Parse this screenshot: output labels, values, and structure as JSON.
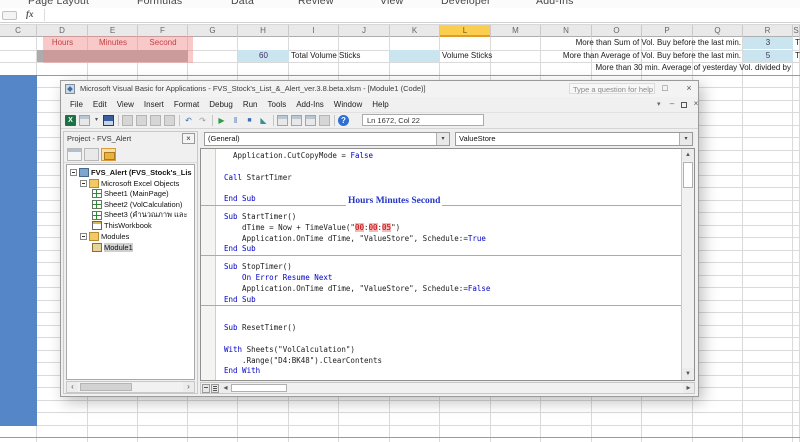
{
  "icons": {
    "minimize": "–",
    "maximize": "□",
    "close": "×",
    "dropdown": "▾",
    "scroll_up": "▲",
    "scroll_down": "▼",
    "scroll_left": "◂",
    "scroll_right": "▸",
    "hsb_left": "‹",
    "hsb_right": "›"
  },
  "colors": {
    "keyword": "#0000C6",
    "code_text": "#1C1C1C",
    "annotation": "#2536C8",
    "highlight_bg": "#F6B8B8",
    "highlight_text": "#C00000",
    "excel_blue_column": "#5587C8",
    "excel_cell_blue": "#CBE5F0",
    "excel_header_selected": "#FBCE4F",
    "excel_label_red": "#9C0006",
    "excel_gray_fill": "#ACACAC",
    "pink_overlay": "rgba(241,132,132,0.45)"
  },
  "excel": {
    "ribbon_tabs": [
      "Page Layout",
      "Formulas",
      "Data",
      "Review",
      "View",
      "Developer",
      "Add-Ins"
    ],
    "fx_label": "fx",
    "columns": [
      "C",
      "D",
      "E",
      "F",
      "G",
      "H",
      "I",
      "J",
      "K",
      "L",
      "M",
      "N",
      "O",
      "P",
      "Q",
      "R",
      "S"
    ],
    "highlighted_column": "L",
    "cells": [
      {
        "col": "D",
        "row": 1,
        "text": "Hours",
        "align": "center",
        "style": "red-label"
      },
      {
        "col": "E",
        "row": 1,
        "text": "Minutes",
        "align": "center",
        "style": "red-label"
      },
      {
        "col": "F",
        "row": 1,
        "text": "Second",
        "align": "center",
        "style": "red-label"
      },
      {
        "col": "D",
        "row": 2,
        "text": "",
        "style": "gray-fill"
      },
      {
        "col": "E",
        "row": 2,
        "text": "",
        "style": "gray-fill"
      },
      {
        "col": "F",
        "row": 2,
        "text": "",
        "style": "gray-fill"
      },
      {
        "col": "H",
        "row": 2,
        "text": "60",
        "align": "center",
        "style": "blue-fill value"
      },
      {
        "cols": [
          "I",
          "J"
        ],
        "row": 2,
        "text": "Total Volume Sticks",
        "align": "left",
        "style": ""
      },
      {
        "col": "K",
        "row": 2,
        "text": "",
        "style": "blue-fill"
      },
      {
        "col": "L",
        "row": 2,
        "text": "Volume Sticks",
        "align": "left",
        "style": ""
      },
      {
        "cols": [
          "M",
          "Q"
        ],
        "row": 1,
        "text": "More than Sum of Vol. Buy before the last min.",
        "align": "right",
        "style": ""
      },
      {
        "col": "R",
        "row": 1,
        "text": "3",
        "align": "center",
        "style": "blue-fill value"
      },
      {
        "cols": [
          "M",
          "Q"
        ],
        "row": 2,
        "text": "More than Average of Vol. Buy before the last min.",
        "align": "right",
        "style": ""
      },
      {
        "col": "R",
        "row": 2,
        "text": "5",
        "align": "center",
        "style": "blue-fill value"
      },
      {
        "cols": [
          "M",
          "R"
        ],
        "row": 3,
        "text": "More than 30 min. Average of yesterday Vol. divided by",
        "align": "right",
        "style": ""
      },
      {
        "col": "S",
        "row": 1,
        "text": "T",
        "align": "left",
        "style": ""
      },
      {
        "col": "S",
        "row": 2,
        "text": "T",
        "align": "left",
        "style": ""
      }
    ]
  },
  "vba": {
    "title": "Microsoft Visual Basic for Applications - FVS_Stock's_List_&_Alert_ver.3.8.beta.xlsm - [Module1 (Code)]",
    "menus": [
      "File",
      "Edit",
      "View",
      "Insert",
      "Format",
      "Debug",
      "Run",
      "Tools",
      "Add-Ins",
      "Window",
      "Help"
    ],
    "help_placeholder": "Type a question for help",
    "status_line": "Ln 1672, Col 22",
    "toolbar": [
      {
        "name": "excel-icon",
        "kind": "excel",
        "glyph": "X"
      },
      {
        "name": "view-object-icon",
        "kind": "win"
      },
      {
        "name": "dropdown-arrow-icon",
        "kind": "dd",
        "glyph": "▾"
      },
      {
        "name": "save-icon",
        "kind": "save"
      },
      {
        "name": "toolbar-separator",
        "kind": "sep"
      },
      {
        "name": "cut-icon",
        "kind": "gray"
      },
      {
        "name": "copy-icon",
        "kind": "gray"
      },
      {
        "name": "paste-icon",
        "kind": "gray"
      },
      {
        "name": "find-icon",
        "kind": "gray"
      },
      {
        "name": "toolbar-separator",
        "kind": "sep"
      },
      {
        "name": "undo-icon",
        "kind": "glyph-blue",
        "glyph": "↶"
      },
      {
        "name": "redo-icon",
        "kind": "glyph-gray",
        "glyph": "↷"
      },
      {
        "name": "toolbar-separator",
        "kind": "sep"
      },
      {
        "name": "run-icon",
        "kind": "glyph-green",
        "glyph": "▶"
      },
      {
        "name": "break-icon",
        "kind": "glyph-blue",
        "glyph": "‖"
      },
      {
        "name": "stop-icon",
        "kind": "glyph-navy",
        "glyph": "■"
      },
      {
        "name": "design-mode-icon",
        "kind": "glyph-teal",
        "glyph": "◣"
      },
      {
        "name": "toolbar-separator",
        "kind": "sep"
      },
      {
        "name": "project-explorer-icon",
        "kind": "win"
      },
      {
        "name": "properties-window-icon",
        "kind": "win"
      },
      {
        "name": "object-browser-icon",
        "kind": "win"
      },
      {
        "name": "toolbox-icon",
        "kind": "gray"
      },
      {
        "name": "toolbar-separator",
        "kind": "sep"
      },
      {
        "name": "help-icon",
        "kind": "glyph-help",
        "glyph": "?"
      }
    ],
    "project": {
      "title": "Project - FVS_Alert",
      "items": [
        {
          "label": "FVS_Alert (FVS_Stock's_Lis",
          "icon": "vbproject",
          "level": 0,
          "expander": true,
          "bold": true
        },
        {
          "label": "Microsoft Excel Objects",
          "icon": "folder",
          "level": 1,
          "expander": true
        },
        {
          "label": "Sheet1 (MainPage)",
          "icon": "worksheet",
          "level": 2
        },
        {
          "label": "Sheet2 (VolCalculation)",
          "icon": "worksheet",
          "level": 2
        },
        {
          "label": "Sheet3 (คำนวณภาพ และ",
          "icon": "worksheet",
          "level": 2
        },
        {
          "label": "ThisWorkbook",
          "icon": "workbook",
          "level": 2
        },
        {
          "label": "Modules",
          "icon": "folder",
          "level": 1,
          "expander": true
        },
        {
          "label": "Module1",
          "icon": "module",
          "level": 2,
          "selected": true
        }
      ]
    },
    "combos": {
      "left": "(General)",
      "right": "ValueStore"
    },
    "annotation": {
      "text": "Hours Minutes Second"
    },
    "code": [
      [
        [
          "n",
          "  Application.CutCopyMode = "
        ],
        [
          "k",
          "False"
        ]
      ],
      "blank",
      [
        [
          "k",
          "Call"
        ],
        [
          "n",
          " StartTimer"
        ]
      ],
      "blank",
      [
        [
          "k",
          "End Sub"
        ]
      ],
      "sep",
      [
        [
          "k",
          "Sub"
        ],
        [
          "n",
          " StartTimer()"
        ]
      ],
      [
        [
          "n",
          "    dTime = Now + TimeValue(\""
        ],
        [
          "hl",
          "00"
        ],
        [
          "n",
          ":"
        ],
        [
          "hl",
          "00"
        ],
        [
          "n",
          ":"
        ],
        [
          "hl",
          "05"
        ],
        [
          "n",
          "\")"
        ]
      ],
      [
        [
          "n",
          "    Application.OnTime dTime, \"ValueStore\", Schedule:="
        ],
        [
          "k",
          "True"
        ]
      ],
      [
        [
          "k",
          "End Sub"
        ]
      ],
      "sep",
      [
        [
          "k",
          "Sub"
        ],
        [
          "n",
          " StopTimer()"
        ]
      ],
      [
        [
          "k",
          "    On Error Resume Next"
        ]
      ],
      [
        [
          "n",
          "    Application.OnTime dTime, \"ValueStore\", Schedule:="
        ],
        [
          "k",
          "False"
        ]
      ],
      [
        [
          "k",
          "End Sub"
        ]
      ],
      "sep",
      "blank",
      [
        [
          "k",
          "Sub"
        ],
        [
          "n",
          " ResetTimer()"
        ]
      ],
      "blank",
      [
        [
          "k",
          "With"
        ],
        [
          "n",
          " Sheets(\"VolCalculation\")"
        ]
      ],
      [
        [
          "n",
          "    .Range(\"D4:BK48\").ClearContents"
        ]
      ],
      [
        [
          "k",
          "End With"
        ]
      ]
    ]
  }
}
